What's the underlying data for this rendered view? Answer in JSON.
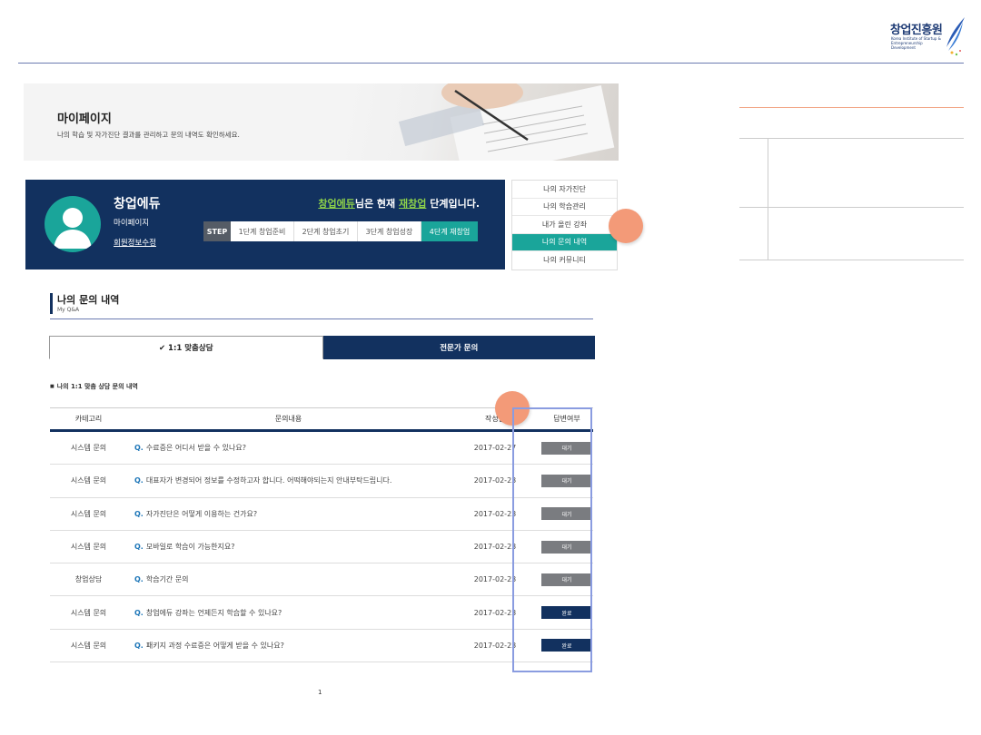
{
  "logo": {
    "title": "창업진흥원",
    "subtitle": "Korea Institute of Startup & Entrepreneurship Development"
  },
  "banner": {
    "title": "마이페이지",
    "description": "나의 학습 및 자가진단 결과를 관리하고 문의 내역도 확인하세요."
  },
  "profile": {
    "name": "창업에듀",
    "mypage_label": "마이페이지",
    "edit_label": "회원정보수정",
    "status": {
      "user": "창업에듀",
      "mid": "님은 현재",
      "stage": "재창업",
      "suffix": "단계입니다."
    },
    "step_label": "STEP",
    "steps": [
      "1단계 창업준비",
      "2단계 창업초기",
      "3단계 창업성장",
      "4단계 재창업"
    ],
    "active_step": 3
  },
  "side_menu": {
    "items": [
      "나의 자가진단",
      "나의 학습관리",
      "내가 올린 강좌",
      "나의 문의 내역",
      "나의 커뮤니티"
    ],
    "active_index": 3
  },
  "section": {
    "title": "나의 문의 내역",
    "subtitle": "My Q&A"
  },
  "tabs": [
    {
      "label": "✔ 1:1 맞춤상담",
      "active": true
    },
    {
      "label": "전문가 문의",
      "active": false
    }
  ],
  "list_caption": "나의 1:1 맞춤 상담 문의 내역",
  "table": {
    "headers": [
      "카테고리",
      "문의내용",
      "작성일",
      "답변여부"
    ],
    "rows": [
      {
        "category": "시스템 문의",
        "q": "Q.",
        "question": "수료증은 어디서 받을 수 있나요?",
        "date": "2017-02-27",
        "status": "대기",
        "status_type": "wait"
      },
      {
        "category": "시스템 문의",
        "q": "Q.",
        "question": "대표자가 변경되어 정보를 수정하고자 합니다. 어떡해야되는지 안내부탁드립니다.",
        "date": "2017-02-23",
        "status": "대기",
        "status_type": "wait"
      },
      {
        "category": "시스템 문의",
        "q": "Q.",
        "question": "자가진단은 어떻게 이용하는 건가요?",
        "date": "2017-02-23",
        "status": "대기",
        "status_type": "wait"
      },
      {
        "category": "시스템 문의",
        "q": "Q.",
        "question": "모바일로 학습이 가능한지요?",
        "date": "2017-02-23",
        "status": "대기",
        "status_type": "wait"
      },
      {
        "category": "창업상담",
        "q": "Q.",
        "question": "학습기간 문의",
        "date": "2017-02-23",
        "status": "대기",
        "status_type": "wait"
      },
      {
        "category": "시스템 문의",
        "q": "Q.",
        "question": "창업에듀 강좌는 언제든지 학습할 수 있나요?",
        "date": "2017-02-23",
        "status": "완료",
        "status_type": "done"
      },
      {
        "category": "시스템 문의",
        "q": "Q.",
        "question": "패키지 과정 수료증은 어떻게 받을 수 있나요?",
        "date": "2017-02-23",
        "status": "완료",
        "status_type": "done"
      }
    ]
  },
  "pagination": {
    "current": "1"
  },
  "colors": {
    "navy": "#12315f",
    "teal": "#1aa59a",
    "marker": "#f39a78",
    "highlight": "#8a9ce0",
    "wait": "#7a7c80"
  }
}
